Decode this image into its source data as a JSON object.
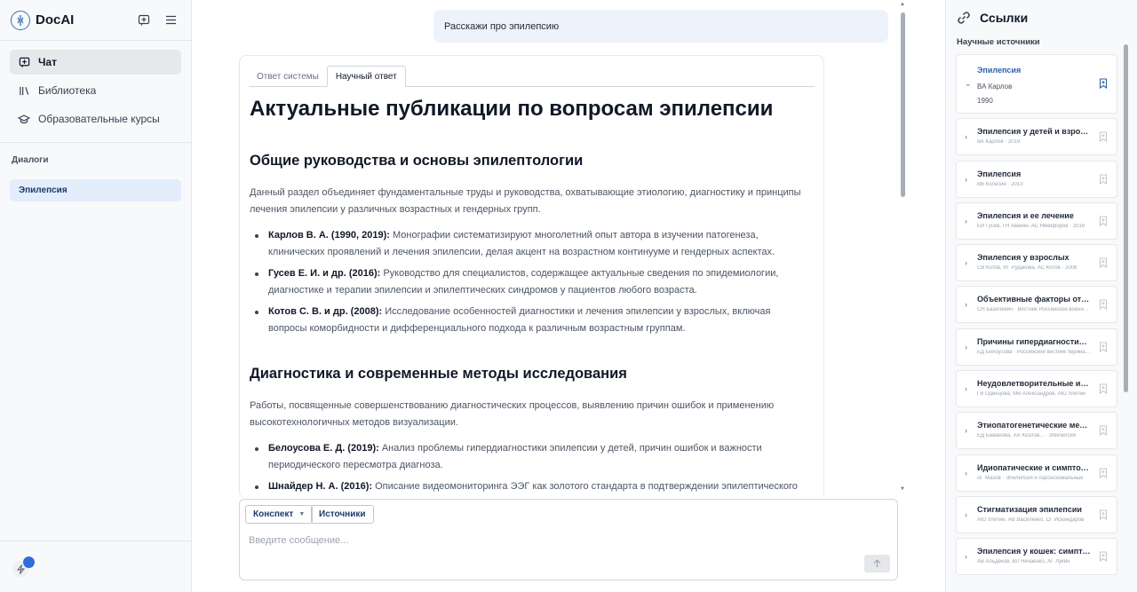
{
  "sidebar": {
    "app_title": "DocAI",
    "nav": [
      {
        "label": "Чат",
        "icon": "chat-plus-icon",
        "active": true
      },
      {
        "label": "Библиотека",
        "icon": "library-icon",
        "active": false
      },
      {
        "label": "Образовательные курсы",
        "icon": "graduation-cap-icon",
        "active": false
      }
    ],
    "dialogs_label": "Диалоги",
    "dialogs": [
      {
        "label": "Эпилепсия",
        "active": true
      }
    ]
  },
  "chat": {
    "user_message": "Расскажи про эпилепсию",
    "tabs": [
      {
        "label": "Ответ системы",
        "active": false
      },
      {
        "label": "Научный ответ",
        "active": true
      }
    ],
    "answer": {
      "title": "Актуальные публикации по вопросам эпилепсии",
      "sections": [
        {
          "heading": "Общие руководства и основы эпилептологии",
          "intro": "Данный раздел объединяет фундаментальные труды и руководства, охватывающие этиологию, диагностику и принципы лечения эпилепсии у различных возрастных и гендерных групп.",
          "items": [
            {
              "author": "Карлов В. А. (1990, 2019):",
              "text": " Монографии систематизируют многолетний опыт автора в изучении патогенеза, клинических проявлений и лечения эпилепсии, делая акцент на возрастном континууме и гендерных аспектах."
            },
            {
              "author": "Гусев Е. И. и др. (2016):",
              "text": " Руководство для специалистов, содержащее актуальные сведения по эпидемиологии, диагностике и терапии эпилепсии и эпилептических синдромов у пациентов любого возраста."
            },
            {
              "author": "Котов С. В. и др. (2008):",
              "text": " Исследование особенностей диагностики и лечения эпилепсии у взрослых, включая вопросы коморбидности и дифференциального подхода к различным возрастным группам."
            }
          ]
        },
        {
          "heading": "Диагностика и современные методы исследования",
          "intro": "Работы, посвященные совершенствованию диагностических процессов, выявлению причин ошибок и применению высокотехнологичных методов визуализации.",
          "items": [
            {
              "author": "Белоусова Е. Д. (2019):",
              "text": " Анализ проблемы гипердиагностики эпилепсии у детей, причин ошибок и важности периодического пересмотра диагноза."
            },
            {
              "author": "Шнайдер Н. А. (2016):",
              "text": " Описание видеомониторинга ЭЭГ как золотого стандарта в подтверждении эпилептического"
            }
          ]
        }
      ]
    },
    "composer": {
      "konspekt_label": "Конспект",
      "sources_label": "Источники",
      "placeholder": "Введите сообщение..."
    }
  },
  "references": {
    "title": "Ссылки",
    "subtitle": "Научные источники",
    "items": [
      {
        "title": "Эпилепсия",
        "author": "ВА Карлов",
        "year": "1990",
        "expanded": true
      },
      {
        "title": "Эпилепсия у детей и взрослых женщин и мужчин",
        "meta": "ВА Карлов · 2019"
      },
      {
        "title": "Эпилепсия",
        "meta": "ВВ Колесин · 2013"
      },
      {
        "title": "Эпилепсия и ее лечение",
        "meta": "ЕИ Гусев, ГН Авакян, АС Никифоров · 2016"
      },
      {
        "title": "Эпилепсия у взрослых",
        "meta": "СВ Котов, ИГ Рудакова, АС Котов · 2008"
      },
      {
        "title": "Объективные факторы отказа от лечения",
        "meta": "СН Базилевич · Вестник Российской военно-медицинской академии"
      },
      {
        "title": "Причины гипердиагностики эпилепсии у детей",
        "meta": "ЕД Белоусова · Российский вестник перинатологии"
      },
      {
        "title": "Неудовлетворительные исходы лечения",
        "meta": "ГВ Одинцова, МВ Александров, АЮ Улитин"
      },
      {
        "title": "Этиопатогенетические механизмы",
        "meta": "ЕД Бажанова, АА Козлов... · Эпилепсия"
      },
      {
        "title": "Идиопатические и симптоматические",
        "meta": "АГ Махов · Эпилепсия и пароксизмальные"
      },
      {
        "title": "Стигматизация эпилепсии",
        "meta": "АЮ Улитин, АВ Василенко, СГ Искандаров"
      },
      {
        "title": "Эпилепсия у кошек: симптомы",
        "meta": "АВ Альдеков, ВЛ Нечаенко, АГ Лукин"
      }
    ]
  },
  "colors": {
    "accent": "#2f5fa8",
    "active_dialog_bg": "#e3edfb",
    "user_bubble_bg": "#eef2fb"
  }
}
